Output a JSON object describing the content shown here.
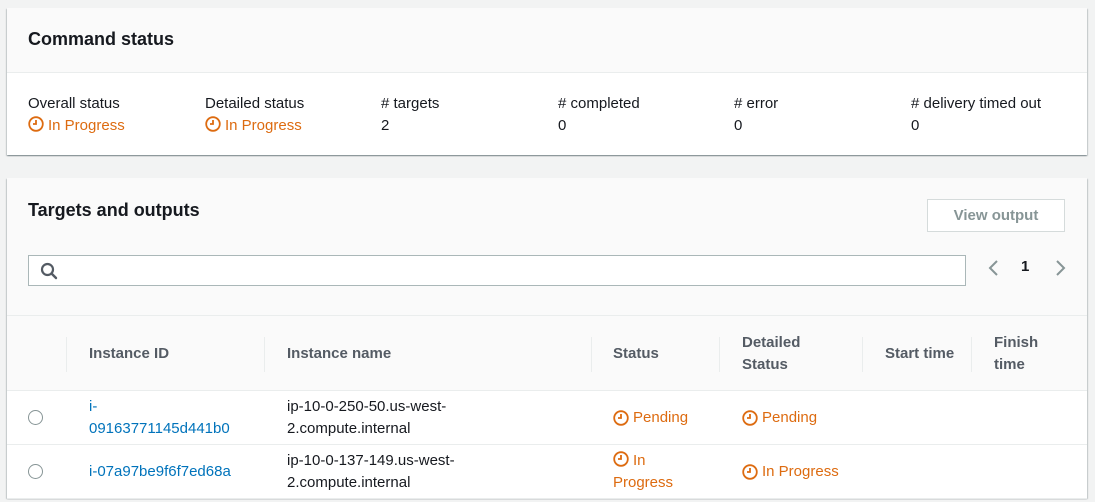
{
  "command_status": {
    "title": "Command status",
    "columns": [
      {
        "label": "Overall status",
        "value": "In Progress",
        "is_status": true
      },
      {
        "label": "Detailed status",
        "value": "In Progress",
        "is_status": true
      },
      {
        "label": "# targets",
        "value": "2",
        "is_status": false
      },
      {
        "label": "# completed",
        "value": "0",
        "is_status": false
      },
      {
        "label": "# error",
        "value": "0",
        "is_status": false
      },
      {
        "label": "# delivery timed out",
        "value": "0",
        "is_status": false
      }
    ]
  },
  "targets": {
    "title": "Targets and outputs",
    "view_output_label": "View output",
    "search": {
      "placeholder": "",
      "value": ""
    },
    "pagination": {
      "current_page": "1"
    },
    "columns": [
      "Instance ID",
      "Instance name",
      "Status",
      "Detailed Status",
      "Start time",
      "Finish time"
    ],
    "rows": [
      {
        "instance_id_line1": "i-",
        "instance_id_line2": "09163771145d441b0",
        "instance_name_line1": "ip-10-0-250-50.us-west-",
        "instance_name_line2": "2.compute.internal",
        "status": "Pending",
        "detailed_status": "Pending",
        "start_time": "",
        "finish_time": ""
      },
      {
        "instance_id": "i-07a97be9f6f7ed68a",
        "instance_name_line1": "ip-10-0-137-149.us-west-",
        "instance_name_line2": "2.compute.internal",
        "status_line1": "In",
        "status_line2": "Progress",
        "detailed_status": "In Progress",
        "start_time": "",
        "finish_time": ""
      }
    ]
  },
  "colors": {
    "status_orange": "#dd6b10",
    "link_blue": "#0073bb"
  },
  "icons": [
    "clock-icon",
    "search-icon",
    "chevron-left-icon",
    "chevron-right-icon"
  ]
}
